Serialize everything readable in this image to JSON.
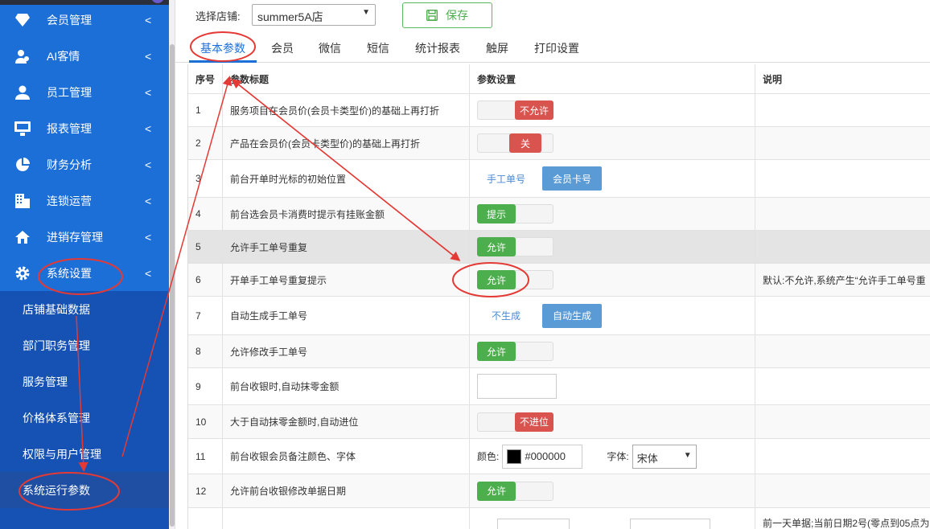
{
  "sidebar": {
    "items": [
      {
        "label": "会员管理",
        "icon": "diamond-icon"
      },
      {
        "label": "AI客情",
        "icon": "user-headset-icon"
      },
      {
        "label": "员工管理",
        "icon": "user-icon"
      },
      {
        "label": "报表管理",
        "icon": "monitor-icon"
      },
      {
        "label": "财务分析",
        "icon": "pie-chart-icon"
      },
      {
        "label": "连锁运营",
        "icon": "building-icon"
      },
      {
        "label": "进销存管理",
        "icon": "home-icon"
      },
      {
        "label": "系统设置",
        "icon": "gear-icon"
      }
    ],
    "chevron": "<",
    "submenu": [
      {
        "label": "店铺基础数据"
      },
      {
        "label": "部门职务管理"
      },
      {
        "label": "服务管理"
      },
      {
        "label": "价格体系管理"
      },
      {
        "label": "权限与用户管理"
      },
      {
        "label": "系统运行参数"
      }
    ]
  },
  "toolbar": {
    "store_label": "选择店铺:",
    "store_value": "summer5A店",
    "save_label": "保存"
  },
  "tabs": [
    "基本参数",
    "会员",
    "微信",
    "短信",
    "统计报表",
    "触屏",
    "打印设置"
  ],
  "table": {
    "headers": [
      "序号",
      "参数标题",
      "参数设置",
      "说明"
    ],
    "rows": [
      {
        "no": "1",
        "title": "服务项目在会员价(会员卡类型价)的基础上再打折",
        "setting": "不允许"
      },
      {
        "no": "2",
        "title": "产品在会员价(会员卡类型价)的基础上再打折",
        "setting": "关"
      },
      {
        "no": "3",
        "title": "前台开单时光标的初始位置",
        "opt_a": "手工单号",
        "opt_b": "会员卡号"
      },
      {
        "no": "4",
        "title": "前台选会员卡消费时提示有挂账金额",
        "setting": "提示"
      },
      {
        "no": "5",
        "title": "允许手工单号重复",
        "setting": "允许"
      },
      {
        "no": "6",
        "title": "开单手工单号重复提示",
        "setting": "允许",
        "note": "默认:不允许,系统产生“允许手工单号重"
      },
      {
        "no": "7",
        "title": "自动生成手工单号",
        "opt_a": "不生成",
        "opt_b": "自动生成"
      },
      {
        "no": "8",
        "title": "允许修改手工单号",
        "setting": "允许"
      },
      {
        "no": "9",
        "title": "前台收银时,自动抹零金额"
      },
      {
        "no": "10",
        "title": "大于自动抹零金额时,自动进位",
        "setting": "不进位"
      },
      {
        "no": "11",
        "title": "前台收银会员备注颜色、字体",
        "color_label": "颜色:",
        "color_value": "#000000",
        "font_label": "字体:",
        "font_value": "宋体"
      },
      {
        "no": "12",
        "title": "允许前台收银修改单据日期",
        "setting": "允许"
      },
      {
        "no": "",
        "title": "",
        "note": "前一天单据;当前日期2号(零点到05点为"
      }
    ]
  },
  "colors": {
    "sidebar": "#1d6fd8",
    "submenu": "#1652b3",
    "on": "#4cae4c",
    "off": "#d9534f",
    "annotation": "#e53935"
  }
}
